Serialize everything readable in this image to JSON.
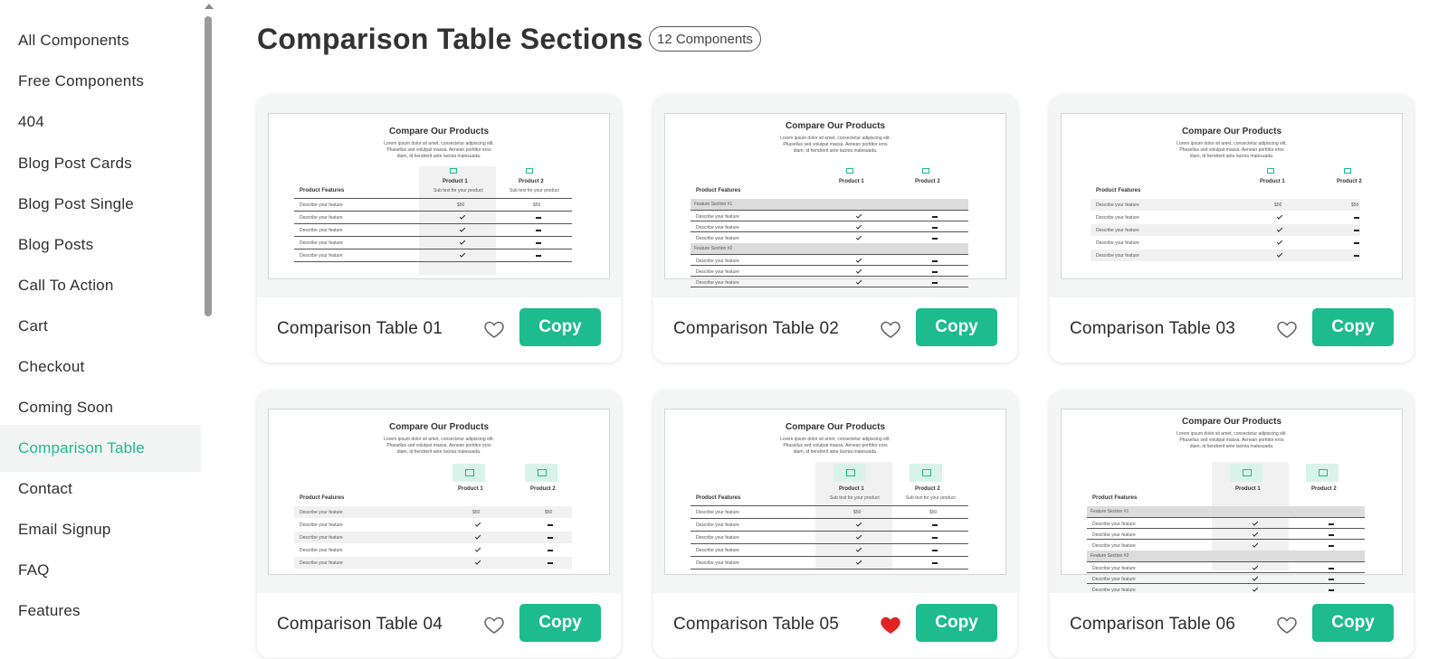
{
  "sidebar": {
    "items": [
      {
        "label": "All Components"
      },
      {
        "label": "Free Components"
      },
      {
        "label": "404"
      },
      {
        "label": "Blog Post Cards"
      },
      {
        "label": "Blog Post Single"
      },
      {
        "label": "Blog Posts"
      },
      {
        "label": "Call To Action"
      },
      {
        "label": "Cart"
      },
      {
        "label": "Checkout"
      },
      {
        "label": "Coming Soon"
      },
      {
        "label": "Comparison Table",
        "active": true
      },
      {
        "label": "Contact"
      },
      {
        "label": "Email Signup"
      },
      {
        "label": "FAQ"
      },
      {
        "label": "Features"
      }
    ]
  },
  "header": {
    "title": "Comparison Table Sections",
    "count_badge": "12 Components"
  },
  "preview": {
    "title": "Compare Our Products",
    "lorem": "Lorem ipsum dolor sit amet, consectetur adipiscing elit. Phasellus sed volutpat massa. Aenean porttitor eros diam, id hendrerit ante lacinia malesuada.",
    "features_header": "Product Features",
    "product1": "Product 1",
    "product2": "Product 2",
    "sub": "Sub text for your product",
    "feature": "Describe your feature",
    "section1": "Feature Section #1",
    "section2": "Feature Section #2",
    "price": "$50"
  },
  "cards": [
    {
      "title": "Comparison Table 01",
      "favorited": false,
      "copy_label": "Copy"
    },
    {
      "title": "Comparison Table 02",
      "favorited": false,
      "copy_label": "Copy"
    },
    {
      "title": "Comparison Table 03",
      "favorited": false,
      "copy_label": "Copy"
    },
    {
      "title": "Comparison Table 04",
      "favorited": false,
      "copy_label": "Copy"
    },
    {
      "title": "Comparison Table 05",
      "favorited": true,
      "copy_label": "Copy"
    },
    {
      "title": "Comparison Table 06",
      "favorited": false,
      "copy_label": "Copy"
    }
  ],
  "colors": {
    "accent": "#1dbb8e",
    "active_text": "#1db98f",
    "favorite": "#e02424",
    "heart_outline": "#666666"
  },
  "icons": {
    "favorite": "heart-icon",
    "thumbnail_product": "laptop-icon",
    "thumbnail_image": "image-icon"
  }
}
